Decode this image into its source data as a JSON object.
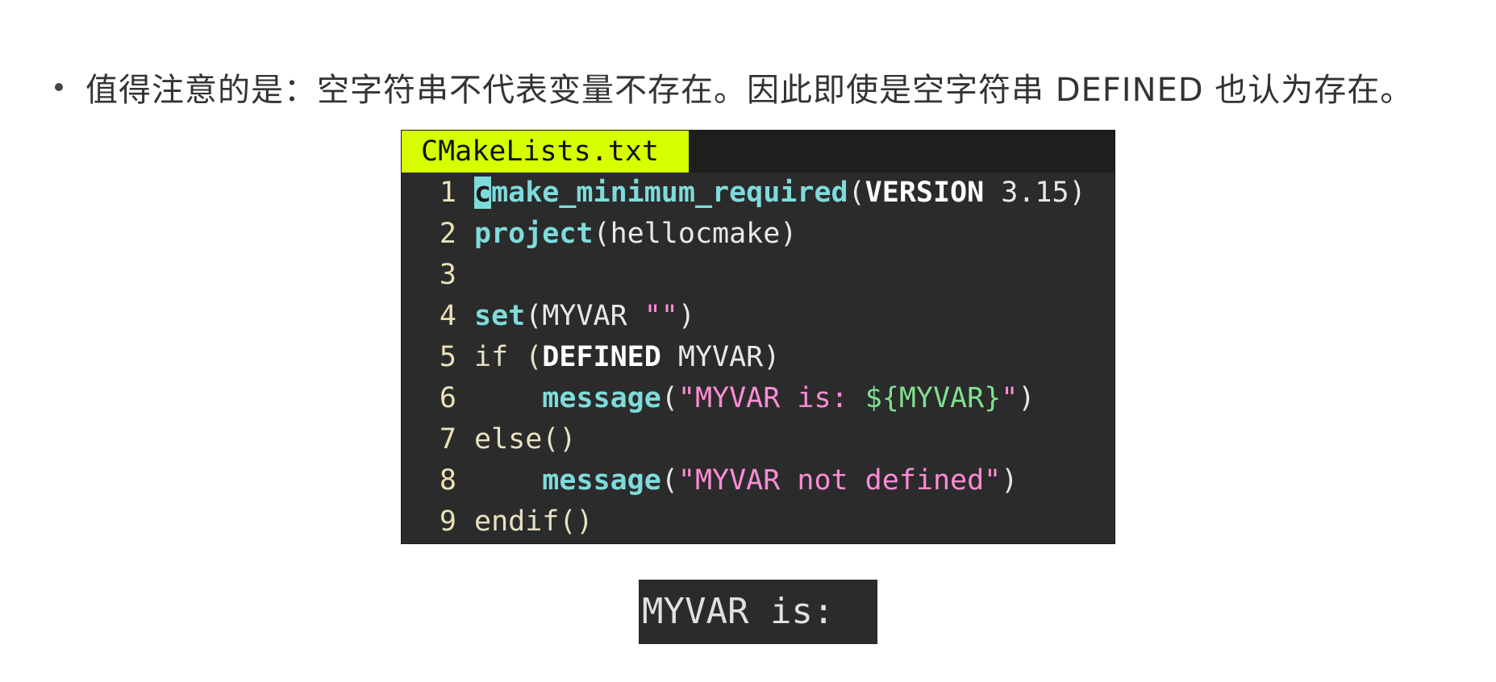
{
  "note": {
    "text": "值得注意的是：空字符串不代表变量不存在。因此即使是空字符串 DEFINED 也认为存在。"
  },
  "editor": {
    "tab_label": "CMakeLists.txt",
    "lines": [
      {
        "num": "1",
        "parts": [
          {
            "t": "c",
            "cls": "kw cursor"
          },
          {
            "t": "make_minimum_required",
            "cls": "kw"
          },
          {
            "t": "(",
            "cls": ""
          },
          {
            "t": "VERSION",
            "cls": "bd"
          },
          {
            "t": " 3.15)",
            "cls": "num"
          }
        ]
      },
      {
        "num": "2",
        "parts": [
          {
            "t": "project",
            "cls": "kw"
          },
          {
            "t": "(hellocmake)",
            "cls": ""
          }
        ]
      },
      {
        "num": "3",
        "parts": []
      },
      {
        "num": "4",
        "parts": [
          {
            "t": "set",
            "cls": "kw"
          },
          {
            "t": "(MYVAR ",
            "cls": ""
          },
          {
            "t": "\"\"",
            "cls": "str"
          },
          {
            "t": ")",
            "cls": ""
          }
        ]
      },
      {
        "num": "5",
        "parts": [
          {
            "t": "if (",
            "cls": "ctl"
          },
          {
            "t": "DEFINED",
            "cls": "bd"
          },
          {
            "t": " MYVAR)",
            "cls": ""
          }
        ]
      },
      {
        "num": "6",
        "parts": [
          {
            "t": "    ",
            "cls": ""
          },
          {
            "t": "message",
            "cls": "kw"
          },
          {
            "t": "(",
            "cls": ""
          },
          {
            "t": "\"MYVAR is: ",
            "cls": "str"
          },
          {
            "t": "${MYVAR}",
            "cls": "var"
          },
          {
            "t": "\"",
            "cls": "str"
          },
          {
            "t": ")",
            "cls": ""
          }
        ]
      },
      {
        "num": "7",
        "parts": [
          {
            "t": "else()",
            "cls": "ctl"
          }
        ]
      },
      {
        "num": "8",
        "parts": [
          {
            "t": "    ",
            "cls": ""
          },
          {
            "t": "message",
            "cls": "kw"
          },
          {
            "t": "(",
            "cls": ""
          },
          {
            "t": "\"MYVAR not defined\"",
            "cls": "str"
          },
          {
            "t": ")",
            "cls": ""
          }
        ]
      },
      {
        "num": "9",
        "parts": [
          {
            "t": "endif()",
            "cls": "ctl"
          }
        ]
      }
    ]
  },
  "output": {
    "text": "MYVAR is:"
  }
}
